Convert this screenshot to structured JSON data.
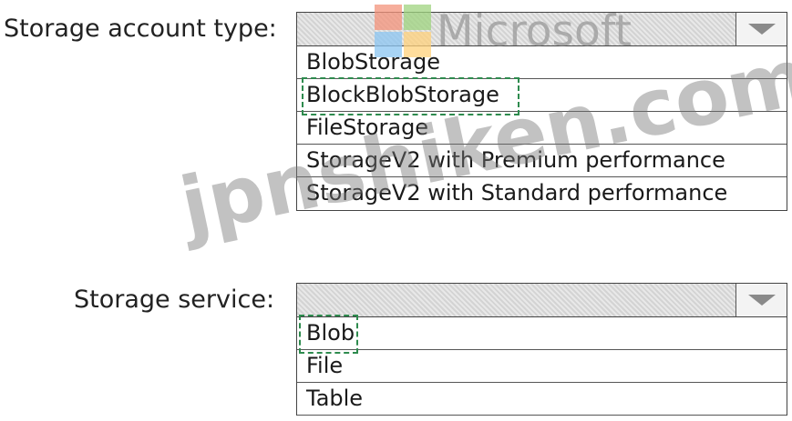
{
  "watermarks": {
    "logo_text": "Microsoft",
    "site_text": "jpnshiken.com"
  },
  "storage_account": {
    "label": "Storage account type:",
    "selected": "",
    "options": [
      "BlobStorage",
      "BlockBlobStorage",
      "FileStorage",
      "StorageV2 with Premium performance",
      "StorageV2 with Standard performance"
    ],
    "marked_option": "BlockBlobStorage"
  },
  "storage_service": {
    "label": "Storage service:",
    "selected": "",
    "options": [
      "Blob",
      "File",
      "Table"
    ],
    "marked_option": "Blob"
  },
  "colors": {
    "selection_marker": "#2e8b4e",
    "dropdown_header": "#dcdcdc",
    "arrow": "#8a8a8a"
  },
  "icons": {
    "dropdown_arrow": "chevron-down-icon"
  }
}
